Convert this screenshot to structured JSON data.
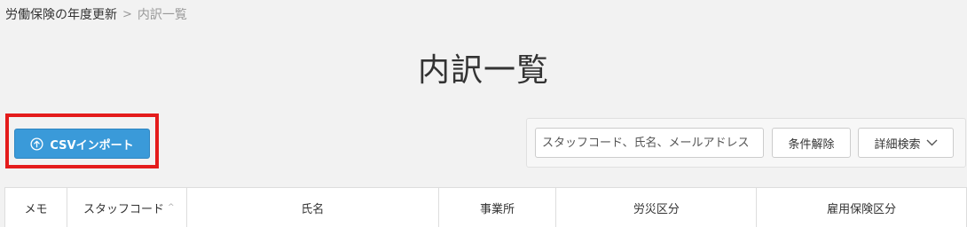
{
  "breadcrumb": {
    "parent": "労働保険の年度更新",
    "separator": ">",
    "current": "内訳一覧"
  },
  "page": {
    "title": "内訳一覧"
  },
  "toolbar": {
    "import_label": "CSVインポート",
    "import_icon": "upload-circle-icon"
  },
  "search": {
    "placeholder": "スタッフコード、氏名、メールアドレス",
    "clear_label": "条件解除",
    "detail_label": "詳細検索",
    "detail_icon": "chevron-down-icon"
  },
  "table": {
    "columns": [
      {
        "label": "メモ"
      },
      {
        "label": "スタッフコード",
        "sortable": true
      },
      {
        "label": "氏名"
      },
      {
        "label": "事業所"
      },
      {
        "label": "労災区分"
      },
      {
        "label": "雇用保険区分"
      }
    ]
  },
  "colors": {
    "primary": "#3a9ad9",
    "highlight": "#e41c1c",
    "background": "#f2f2f2"
  }
}
